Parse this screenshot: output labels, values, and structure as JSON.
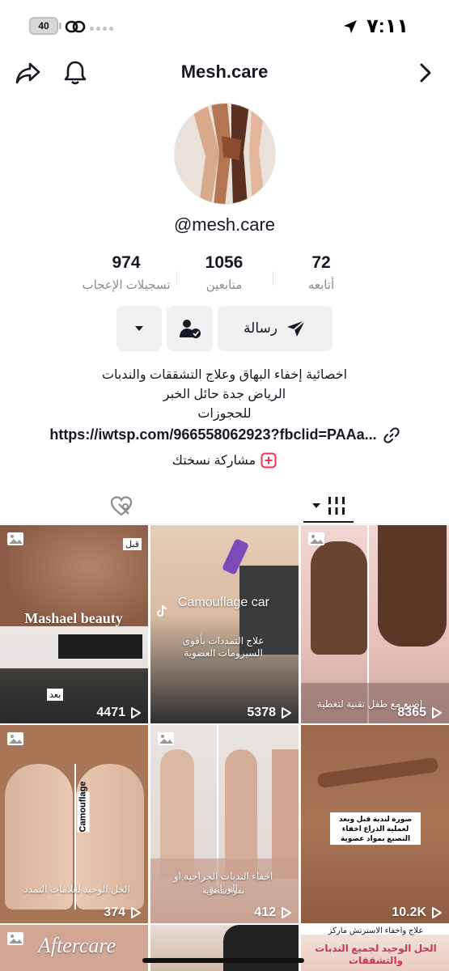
{
  "status_bar": {
    "time": "٧:١١",
    "battery_text": "40"
  },
  "nav": {
    "title": "Mesh.care"
  },
  "profile": {
    "username": "@mesh.care"
  },
  "stats": {
    "likes_num": "974",
    "likes_label": "تسجيلات الإعجاب",
    "followers_num": "1056",
    "followers_label": "متابعين",
    "following_num": "72",
    "following_label": "أتابعه"
  },
  "actions": {
    "message_label": "رسالة"
  },
  "bio": {
    "line1": "اخصائية إخفاء البهاق وعلاج التشققات والندبات",
    "line2": "الرياض جدة حائل الخبر",
    "line3": "للحجوزات",
    "link": "https://iwtsp.com/966558062923?fbclid=PAAa...",
    "share": "مشاركة نسختك"
  },
  "colors": {
    "accent_pink": "#fe2c55",
    "text": "#161823",
    "muted": "#8a8b91"
  },
  "grid": {
    "tiles": [
      {
        "views": "4471",
        "badge": "image-icon",
        "overlay": "Mashael beauty",
        "caption": "قبل",
        "label": "بعد"
      },
      {
        "views": "5378",
        "badge": "tiktok-icon",
        "overlay": "Camouflage car",
        "caption": "علاج التمددات بأقوى السيرومات العضوية"
      },
      {
        "views": "8365",
        "badge": "image-icon",
        "caption": "اصبع مع طفل تقنية لتغطية"
      },
      {
        "views": "374",
        "badge": "image-icon",
        "overlay": "Camouflage",
        "caption": "الحل الوحيد لعلامات التمدد"
      },
      {
        "views": "412",
        "badge": "image-icon",
        "caption": "اخفاء الندبات الجراحية او الوراثية",
        "sub": "بمواد عضوية"
      },
      {
        "views": "10.2K",
        "badge": "none",
        "caption": "صورة لندبة قبل وبعد لعملية الذراع اخفاء التصبغ بمواد عضوية"
      },
      {
        "views": "",
        "badge": "image-icon",
        "overlay": "Aftercare"
      },
      {
        "views": "",
        "badge": "none"
      },
      {
        "views": "",
        "badge": "none",
        "caption": "علاج واخفاء الاسترتش ماركز",
        "sub": "الحل الوحيد لجميع الندبات والتشققات"
      }
    ]
  }
}
